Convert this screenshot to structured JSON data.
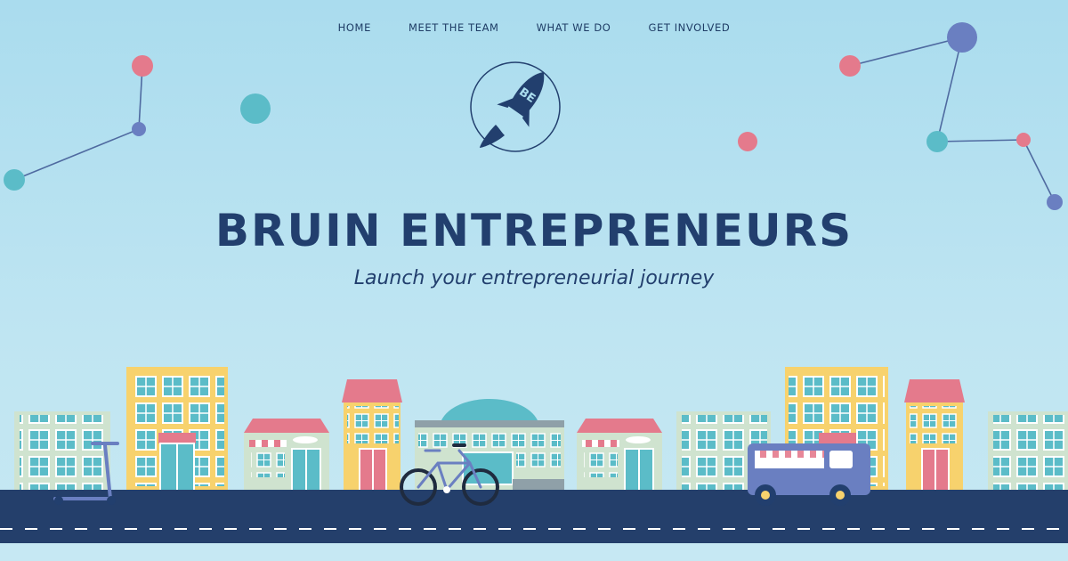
{
  "nav": {
    "items": [
      {
        "label": "HOME"
      },
      {
        "label": "MEET THE TEAM"
      },
      {
        "label": "WHAT WE DO"
      },
      {
        "label": "GET INVOLVED"
      }
    ]
  },
  "logo": {
    "initials": "BE",
    "icon": "rocket-icon"
  },
  "hero": {
    "title": "BRUIN ENTREPRENEURS",
    "subtitle": "Launch your entrepreneurial journey"
  },
  "colors": {
    "navy": "#223f6e",
    "sky": "#aadcee",
    "pink": "#e47a8c",
    "teal": "#5bbcc8",
    "blue": "#6a7fc1",
    "yellow": "#f7d26d",
    "mint": "#cfe3cf",
    "road": "#243f6b"
  }
}
